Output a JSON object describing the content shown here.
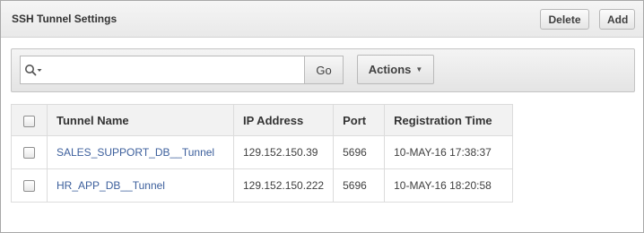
{
  "panel": {
    "title": "SSH Tunnel Settings",
    "delete_label": "Delete",
    "add_label": "Add"
  },
  "toolbar": {
    "search_value": "",
    "go_label": "Go",
    "actions_label": "Actions"
  },
  "table": {
    "columns": [
      "Tunnel Name",
      "IP Address",
      "Port",
      "Registration Time"
    ],
    "rows": [
      {
        "name": "SALES_SUPPORT_DB__Tunnel",
        "ip": "129.152.150.39",
        "port": "5696",
        "time": "10-MAY-16 17:38:37"
      },
      {
        "name": "HR_APP_DB__Tunnel",
        "ip": "129.152.150.222",
        "port": "5696",
        "time": "10-MAY-16 18:20:58"
      }
    ]
  },
  "icons": {
    "search": "search-icon",
    "dropdown": "caret-down-icon"
  }
}
